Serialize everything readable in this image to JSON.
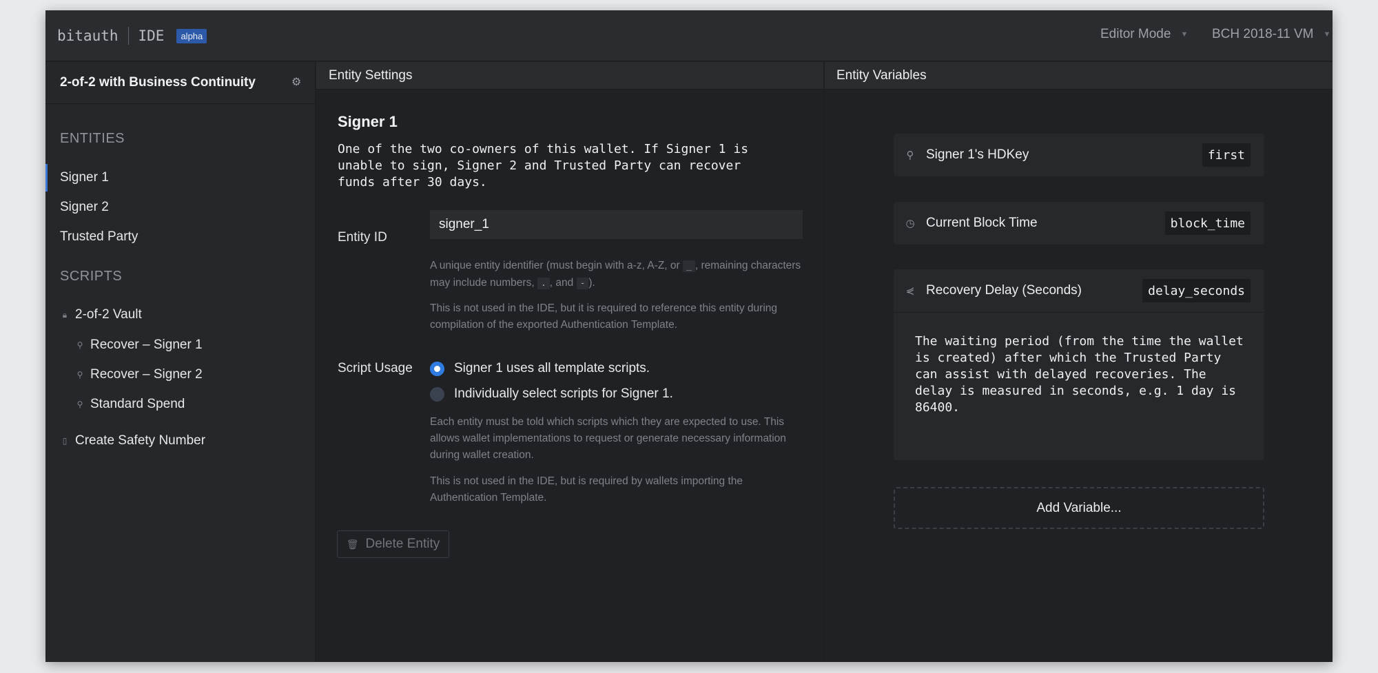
{
  "header": {
    "brand": "bitauth",
    "product": "IDE",
    "badge": "alpha",
    "mode_select": "Editor Mode",
    "vm_select": "BCH 2018-11 VM"
  },
  "sidebar": {
    "template_title": "2-of-2 with Business Continuity",
    "entities_heading": "ENTITIES",
    "entities": [
      {
        "label": "Signer 1",
        "active": true
      },
      {
        "label": "Signer 2",
        "active": false
      },
      {
        "label": "Trusted Party",
        "active": false
      }
    ],
    "scripts_heading": "SCRIPTS",
    "scripts": [
      {
        "label": "2-of-2 Vault",
        "icon": "lock-icon"
      },
      {
        "label": "Recover – Signer 1",
        "icon": "key-icon"
      },
      {
        "label": "Recover – Signer 2",
        "icon": "key-icon"
      },
      {
        "label": "Standard Spend",
        "icon": "key-icon"
      },
      {
        "label": "Create Safety Number",
        "icon": "document-icon"
      }
    ]
  },
  "center": {
    "panel_title": "Entity Settings",
    "entity_name": "Signer 1",
    "entity_description": "One of the two co-owners of this wallet. If Signer 1 is unable to sign, Signer 2 and Trusted Party can recover funds after 30 days.",
    "entity_id_label": "Entity ID",
    "entity_id_value": "signer_1",
    "id_help_1a": "A unique entity identifier (must begin with a-z, A-Z, or",
    "id_help_code_underscore": "_",
    "id_help_1b": ", remaining characters may include numbers,",
    "id_help_code_dot": ".",
    "id_help_1c": ", and",
    "id_help_code_dash": "-",
    "id_help_1d": ").",
    "id_help_2": "This is not used in the IDE, but it is required to reference this entity during compilation of the exported Authentication Template.",
    "script_usage_label": "Script Usage",
    "radio_all": "Signer 1 uses all template scripts.",
    "radio_individual": "Individually select scripts for Signer 1.",
    "usage_help_1": "Each entity must be told which scripts which they are expected to use. This allows wallet implementations to request or generate necessary information during wallet creation.",
    "usage_help_2": "This is not used in the IDE, but is required by wallets importing the Authentication Template.",
    "delete_button": "Delete Entity"
  },
  "right": {
    "panel_title": "Entity Variables",
    "variables": [
      {
        "name": "Signer 1's HDKey",
        "id": "first",
        "icon": "key-icon"
      },
      {
        "name": "Current Block Time",
        "id": "block_time",
        "icon": "clock-icon"
      },
      {
        "name": "Recovery Delay (Seconds)",
        "id": "delay_seconds",
        "icon": "share-icon",
        "description": "The waiting period (from the time the wallet is created) after which the Trusted Party can assist with delayed recoveries. The delay is measured in seconds, e.g. 1 day is 86400."
      }
    ],
    "add_variable_button": "Add Variable..."
  },
  "colors": {
    "accent": "#2f7be0",
    "badge": "#2d5aa8",
    "background": "#202226"
  }
}
